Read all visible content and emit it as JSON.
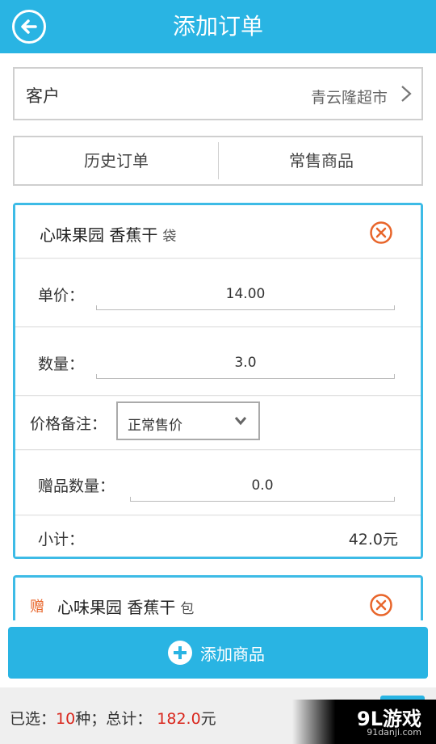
{
  "header": {
    "title": "添加订单"
  },
  "customer": {
    "label": "客户",
    "value": "青云隆超市"
  },
  "tabs": [
    {
      "label": "历史订单"
    },
    {
      "label": "常售商品"
    }
  ],
  "items": [
    {
      "name": "心味果园 香蕉干",
      "unit": "袋",
      "price_label": "单价：",
      "price": "14.00",
      "qty_label": "数量：",
      "qty": "3.0",
      "note_label": "价格备注：",
      "note_value": "正常售价",
      "gift_qty_label": "赠品数量：",
      "gift_qty": "0.0",
      "subtotal_label": "小计：",
      "subtotal": "42.0元"
    },
    {
      "tag": "赠",
      "name": "心味果园 香蕉干",
      "unit": "包"
    }
  ],
  "add_button": {
    "label": "添加商品"
  },
  "footer": {
    "selected_prefix": "已选：",
    "selected_count": "10",
    "selected_suffix": "种；总计：",
    "total": "182.0",
    "total_unit": "元"
  },
  "watermark": {
    "main": "9L游戏",
    "sub": "91danji.com"
  },
  "colors": {
    "accent": "#29b4e3",
    "danger": "#e8652a",
    "total_red": "#d9261c"
  }
}
